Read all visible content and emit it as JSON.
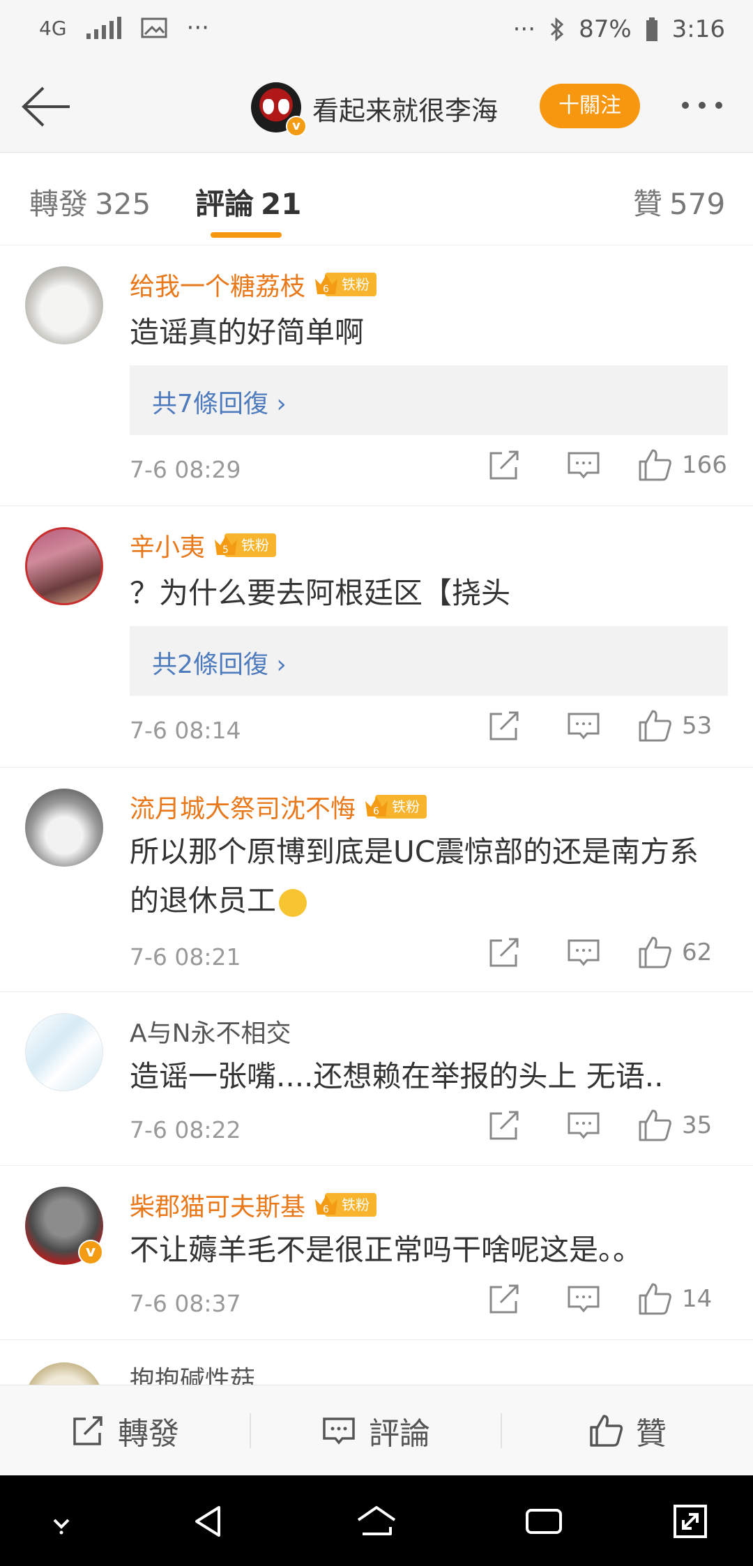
{
  "status_bar": {
    "network": "4G",
    "battery": "87%",
    "time": "3:16",
    "more_left": "···",
    "more_right": "···"
  },
  "header": {
    "title": "看起来就很李海",
    "follow_label": "十關注"
  },
  "tabs": [
    {
      "label": "轉發",
      "count": "325"
    },
    {
      "label": "評論",
      "count": "21"
    },
    {
      "label": "贊",
      "count": "579"
    }
  ],
  "comments": [
    {
      "name": "给我一个糖荔枝",
      "level": "6",
      "badge": "铁粉",
      "text": "造谣真的好简单啊",
      "replies": "共7條回復",
      "time": "7-6 08:29",
      "likes": "166"
    },
    {
      "name": "辛小夷",
      "level": "5",
      "badge": "铁粉",
      "text": "？为什么要去阿根廷区【挠头",
      "replies": "共2條回復",
      "time": "7-6 08:14",
      "likes": "53"
    },
    {
      "name": "流月城大祭司沈不悔",
      "level": "6",
      "badge": "铁粉",
      "text": "所以那个原博到底是UC震惊部的还是南方系的退休员工",
      "time": "7-6 08:21",
      "likes": "62"
    },
    {
      "name": "A与N永不相交",
      "text": "造谣一张嘴....还想赖在举报的头上 无语..",
      "time": "7-6 08:22",
      "likes": "35"
    },
    {
      "name": "柴郡猫可夫斯基",
      "level": "6",
      "badge": "铁粉",
      "text": "不让薅羊毛不是很正常吗干啥呢这是。。",
      "time": "7-6 08:37",
      "likes": "14"
    },
    {
      "name": "抱抱碱性菇"
    }
  ],
  "bottom_bar": {
    "repost": "轉發",
    "comment": "評論",
    "like": "贊"
  },
  "colors": {
    "accent": "#f7960f",
    "username": "#e8781a",
    "link": "#4e7bbd"
  }
}
